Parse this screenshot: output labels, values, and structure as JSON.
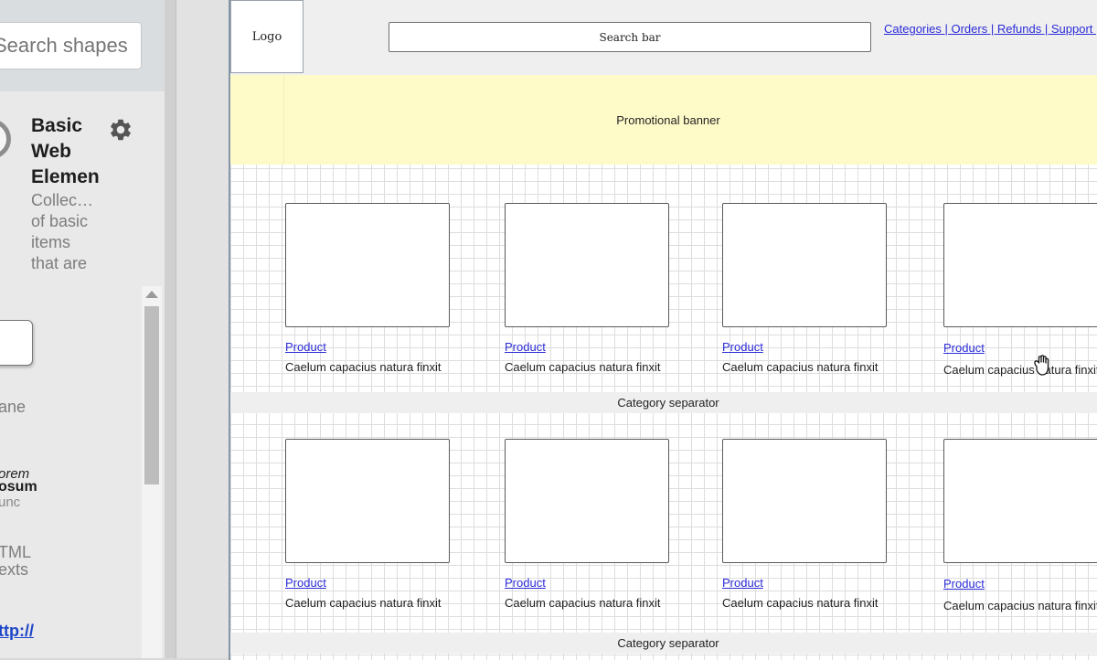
{
  "library": {
    "search_placeholder": "Search shapes",
    "title": "Basic\nWeb\nElemen",
    "description": "Collec…\nof basic\nitems\nthat are",
    "pane_label": "ane",
    "lorem_italic": "orem",
    "ipsum_bold": "osum",
    "nunc_text": "unc",
    "html_label": "TML\nexts",
    "http_link": "ttp://"
  },
  "mockup": {
    "logo": "Logo",
    "search_bar": "Search bar",
    "nav_links": [
      "Categories",
      "Orders",
      "Refunds",
      "Support"
    ],
    "promo_banner": "Promotional banner",
    "category_separator": "Category separator",
    "product_link": "Product",
    "product_desc": "Caelum capacius natura finxit",
    "rows": 2,
    "products_per_row": 4
  },
  "icons": {
    "gear": "gear-icon",
    "cursor": "hand-cursor-icon"
  }
}
